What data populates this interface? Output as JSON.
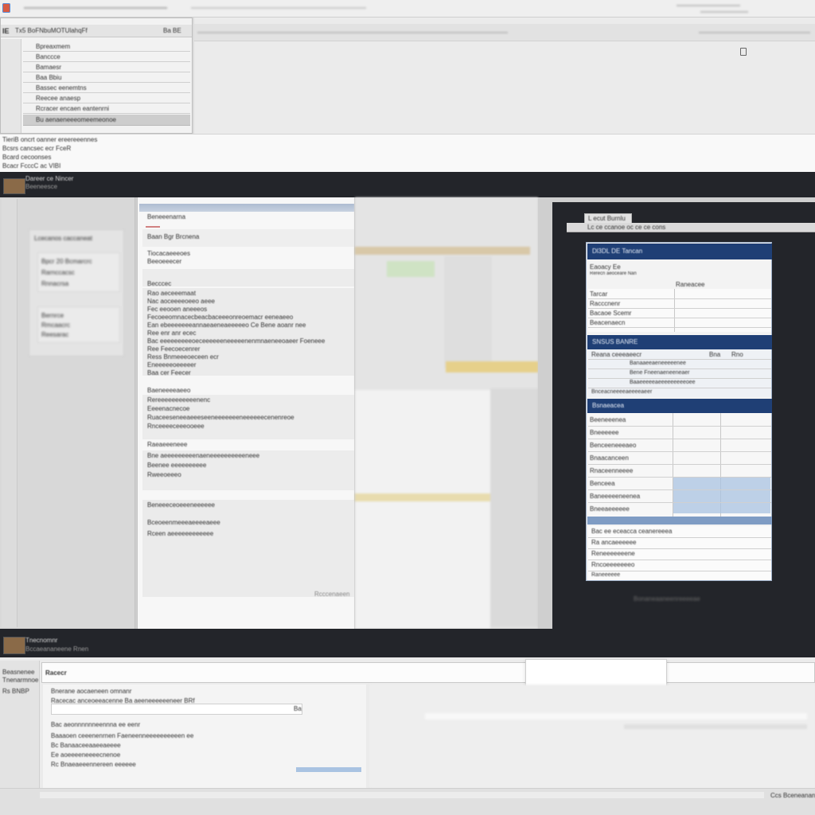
{
  "app": {
    "tab_label": "IE",
    "titlebar_text": "Tx5 BoFNbuMOTUlahqFf",
    "corner_label": "Ba BE"
  },
  "top_list": {
    "items": [
      "Bpreaxmem",
      "Banccce",
      "Bamaesr",
      "Baa Bbiu",
      "Bassec eenemtns",
      "Reecee anaesp",
      "Rcracer encaen eantenrni",
      "Bu aenaeneeeomeemeonoe"
    ]
  },
  "info_strip": {
    "lines": [
      "TieriB oncrt oanner ereereeennes",
      "Bcsrs cancsec ecr FceR",
      "Bcard cecoonses",
      "Bcacr FcccC ac VIBI"
    ]
  },
  "dark_header": {
    "thumb_label": "Dareer ce Nincer",
    "thumb_sub": "Beeneesce"
  },
  "left_card": {
    "lines": [
      "Lcecanos caccaneat",
      "Bpcr 20 Bcmarcrc",
      "Rarnccacsc",
      "Rnnacrsa",
      "Bernrce",
      "Rmcaacrc",
      "Reesarac"
    ]
  },
  "center_doc": {
    "header_label": "Beneeenarna",
    "subheader_label": "Baan Bgr Brcnena",
    "lines": [
      "Tiocacaeeeoes",
      "Beeoeeecer",
      "Becccec",
      "Rao aeceeemaat",
      "Nac aoceeeeoeeo aeee",
      "Fec eeooen aneeeos",
      "Fecoeeomnacecbeacbaceeeonreoemacr eeneaeeo",
      "Ean ebeeeeeeeannaeaeneaeeeeeo Ce Bene aoanr nee",
      "Ree enr anr ecec",
      "Bac eeeeeeeeeoeceeeeeeneeeeenenmnaeneeoaeer Foeneee",
      "Ree Feecoecenrer",
      "Ress Bnmeeeoeceen ecr",
      "Eneeeeeoeeeeer",
      "Baa cer Feecer",
      "Baeneeeeaeeo",
      "Rereeeeeeeeeeenenc",
      "Eeeenacnecoe",
      "Ruaceeseneeaeeeseeneeeeeeeneeeeeecenenreoe",
      "Rnceeeeceeeooeee",
      "Raeaeeeneee",
      "Bne aeeeeeeeeenaeneeeeeeeeeeneee",
      "Beenee eeeeeeeeee",
      "Rweeoeeeo",
      "Beneeeceoeeeneeeeee",
      "Bceoeenmeeeaeeeeaeee",
      "Rceen aeeeeeeeeeeee"
    ],
    "footer_label": "Rcccenaeen"
  },
  "right_popup": {
    "tab_label": "L ecut Burnlu",
    "toolbar_label": "Lc ce ccanoe oc ce ce cons",
    "section1_title": "Dl3DL DE Tancan",
    "section1_sub": "Eaoacy Ee",
    "section1_sub2": "Rerecn aeoceare Nan",
    "section1_right": "Raneacee",
    "section1_rows": [
      "Tarcar",
      "Racccnenr",
      "Bacaoe Scemr",
      "Beacenaecn"
    ],
    "section2_title": "SNSUS BANRE",
    "section2_head": [
      "Reana ceeeaeecr",
      "Bna",
      "Rno"
    ],
    "section2_rows": [
      "Banaaeeaeneeeeenee",
      "Bene Fneenaeneeneaer",
      "Baaeeeeeaeeeeeeeeeoee",
      "Bnceacneeeeaeeeeaeer"
    ],
    "section3_title": "Bsnaeacea",
    "section3_rows": [
      "Beeneeenea",
      "Bneeeeee",
      "Benceeneeeaeo",
      "Bnaacanceen",
      "Rnaceenneeee",
      "Benceea",
      "Baneeeeeneenea",
      "Bneeaeeeeee"
    ],
    "footer_rows": [
      "Bac ee eceacca ceanereeea",
      "Ra ancaeeeeee",
      "Reneeeeeeene",
      "Rncoeeeeeeeo",
      "Raneeeeee"
    ],
    "bottom_label": "Bonaneaaneenreeeeae"
  },
  "bottom_bar": {
    "thumb_label": "Tnecnomnr",
    "thumb_sub": "Bccaeananeene Rnen"
  },
  "bottom_panel": {
    "side_labels": [
      "Beasnenee",
      "Tnenarmnoe",
      "Rs BNBP"
    ],
    "search_value": "Racecr",
    "lines": [
      "Bnerane aocaeneen omnanr",
      "Racecac anceoeeacenne Ba aeeneeeeeeneer BRf",
      "Bac aeonnnnnneennna ee eenr",
      "Baaaoen ceeenenrnen Faeneenneeeeeeeeeen ee",
      "Bc Banaaceeaaeeaeeee",
      "Ee aoeeeeneeeecnenoe",
      "Rc Bnaeaeeennereen eeeeee"
    ],
    "field_value": "Ba",
    "status_right": "Ccs Bceneanan"
  },
  "colors": {
    "navy": "#1f3f75",
    "dark_band": "#23252a",
    "panel_grey": "#e9e9e9",
    "selection_blue": "#a9c3e2"
  }
}
